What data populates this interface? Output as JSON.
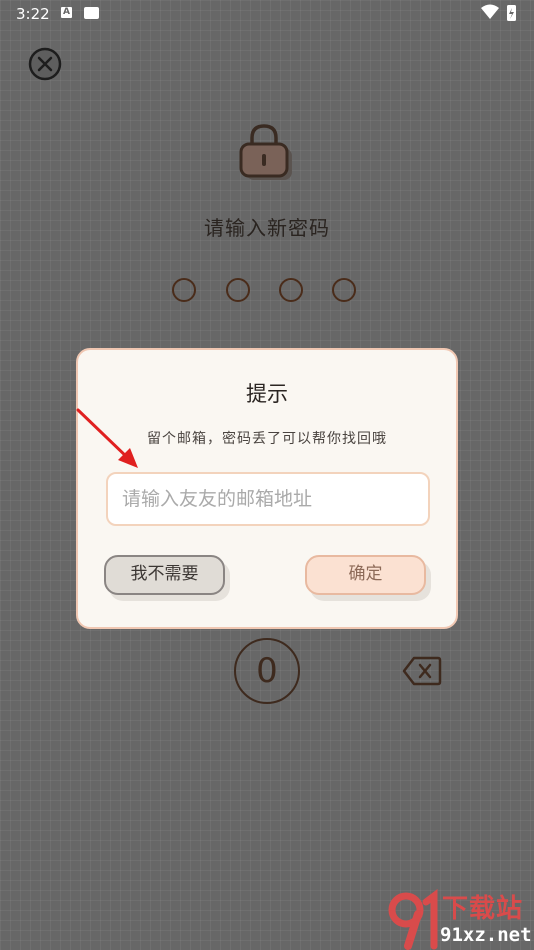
{
  "status_bar": {
    "time": "3:22",
    "icon_a_label": "A",
    "icons": [
      "notification-a-icon",
      "message-icon",
      "wifi-icon",
      "battery-charging-icon"
    ]
  },
  "screen": {
    "prompt_title": "请输入新密码",
    "pin_length": 4,
    "keypad_visible_key": "0"
  },
  "dialog": {
    "title": "提示",
    "message": "留个邮箱，密码丢了可以帮你找回哦",
    "email_input": {
      "value": "",
      "placeholder": "请输入友友的邮箱地址"
    },
    "cancel_label": "我不需要",
    "confirm_label": "确定"
  },
  "watermark": {
    "top": "下载站",
    "bottom": "91xz.net"
  },
  "colors": {
    "overlay": "#676767",
    "dialog_bg": "#faf7f2",
    "dialog_border": "#f0c7b2",
    "confirm_bg": "#fbe1d2",
    "pin_outline": "#4a2c1a",
    "arrow": "#e02020"
  }
}
